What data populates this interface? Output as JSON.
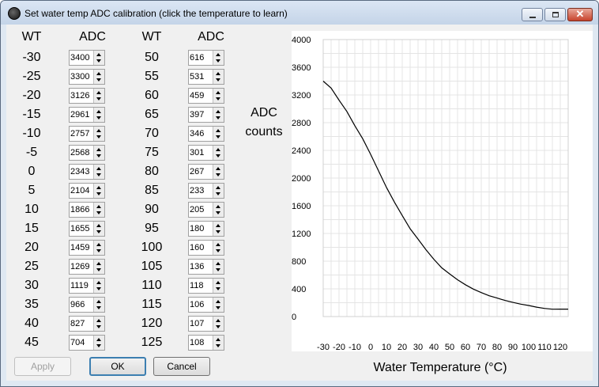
{
  "window": {
    "title": "Set water temp ADC calibration (click the temperature to learn)",
    "controls": [
      "minimize",
      "maximize",
      "close"
    ]
  },
  "table": {
    "header_wt": "WT",
    "header_adc": "ADC",
    "left": [
      {
        "wt": "-30",
        "adc": "3400"
      },
      {
        "wt": "-25",
        "adc": "3300"
      },
      {
        "wt": "-20",
        "adc": "3126"
      },
      {
        "wt": "-15",
        "adc": "2961"
      },
      {
        "wt": "-10",
        "adc": "2757"
      },
      {
        "wt": "-5",
        "adc": "2568"
      },
      {
        "wt": "0",
        "adc": "2343"
      },
      {
        "wt": "5",
        "adc": "2104"
      },
      {
        "wt": "10",
        "adc": "1866"
      },
      {
        "wt": "15",
        "adc": "1655"
      },
      {
        "wt": "20",
        "adc": "1459"
      },
      {
        "wt": "25",
        "adc": "1269"
      },
      {
        "wt": "30",
        "adc": "1119"
      },
      {
        "wt": "35",
        "adc": "966"
      },
      {
        "wt": "40",
        "adc": "827"
      },
      {
        "wt": "45",
        "adc": "704"
      }
    ],
    "right": [
      {
        "wt": "50",
        "adc": "616"
      },
      {
        "wt": "55",
        "adc": "531"
      },
      {
        "wt": "60",
        "adc": "459"
      },
      {
        "wt": "65",
        "adc": "397"
      },
      {
        "wt": "70",
        "adc": "346"
      },
      {
        "wt": "75",
        "adc": "301"
      },
      {
        "wt": "80",
        "adc": "267"
      },
      {
        "wt": "85",
        "adc": "233"
      },
      {
        "wt": "90",
        "adc": "205"
      },
      {
        "wt": "95",
        "adc": "180"
      },
      {
        "wt": "100",
        "adc": "160"
      },
      {
        "wt": "105",
        "adc": "136"
      },
      {
        "wt": "110",
        "adc": "118"
      },
      {
        "wt": "115",
        "adc": "106"
      },
      {
        "wt": "120",
        "adc": "107"
      },
      {
        "wt": "125",
        "adc": "108"
      }
    ]
  },
  "buttons": {
    "apply": "Apply",
    "ok": "OK",
    "cancel": "Cancel"
  },
  "chart_data": {
    "type": "line",
    "title": "",
    "xlabel": "Water Temperature (°C)",
    "ylabel_line1": "ADC",
    "ylabel_line2": "counts",
    "xlim": [
      -30,
      125
    ],
    "ylim": [
      0,
      4000
    ],
    "x_ticks": [
      "-30",
      "-20",
      "-10",
      "0",
      "10",
      "20",
      "30",
      "40",
      "50",
      "60",
      "70",
      "80",
      "90",
      "100",
      "110",
      "120"
    ],
    "y_ticks": [
      "4000",
      "3600",
      "3200",
      "2800",
      "2400",
      "2000",
      "1600",
      "1200",
      "800",
      "400",
      "0"
    ],
    "grid": true,
    "series": [
      {
        "x": [
          -30,
          -25,
          -20,
          -15,
          -10,
          -5,
          0,
          5,
          10,
          15,
          20,
          25,
          30,
          35,
          40,
          45,
          50,
          55,
          60,
          65,
          70,
          75,
          80,
          85,
          90,
          95,
          100,
          105,
          110,
          115,
          120,
          125
        ],
        "y": [
          3400,
          3300,
          3126,
          2961,
          2757,
          2568,
          2343,
          2104,
          1866,
          1655,
          1459,
          1269,
          1119,
          966,
          827,
          704,
          616,
          531,
          459,
          397,
          346,
          301,
          267,
          233,
          205,
          180,
          160,
          136,
          118,
          106,
          107,
          108
        ]
      }
    ]
  }
}
